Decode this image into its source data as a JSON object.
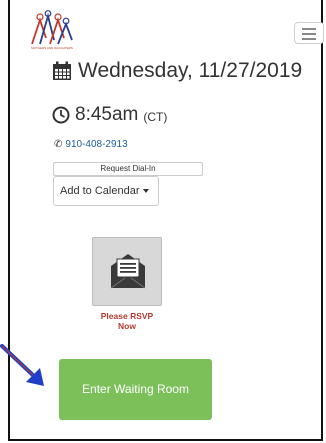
{
  "header": {
    "logo_icon": "organization-logo",
    "logo_caption": "MOTHERS AND DAUGHTERS",
    "menu_icon": "hamburger-menu-icon"
  },
  "event": {
    "date_icon": "calendar-icon",
    "date": "Wednesday, 11/27/2019",
    "time_icon": "clock-icon",
    "time": "8:45am",
    "timezone": "(CT)",
    "phone_icon": "phone-icon",
    "phone": "910-408-2913"
  },
  "actions": {
    "request_dialin": "Request Dial-In",
    "add_to_calendar": "Add to Calendar"
  },
  "rsvp": {
    "icon": "envelope-icon",
    "label_line1": "Please RSVP",
    "label_line2": "Now"
  },
  "waiting_room": {
    "label": "Enter Waiting Room",
    "color": "#7cc05a"
  },
  "annotation": {
    "arrow_color": "#1f3fc8"
  }
}
